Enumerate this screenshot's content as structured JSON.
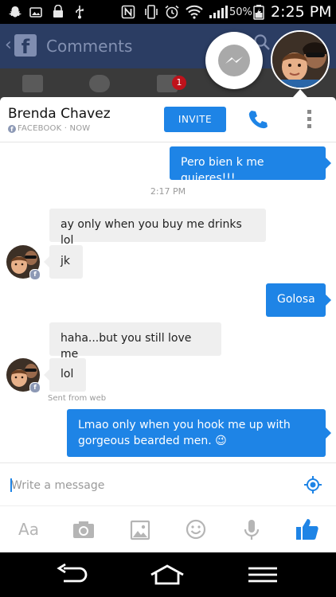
{
  "status_bar": {
    "battery": "50%",
    "time": "2:25 PM"
  },
  "background_app": {
    "title": "Comments",
    "notification_count": "1"
  },
  "chat": {
    "contact_name": "Brenda Chavez",
    "source": "FACEBOOK",
    "presence": "NOW",
    "invite_label": "INVITE"
  },
  "messages": [
    {
      "dir": "out",
      "text": "Pero bien k me quieres!!!"
    },
    {
      "type": "timestamp",
      "text": "2:17 PM"
    },
    {
      "dir": "in",
      "text": "ay only when you buy me drinks lol"
    },
    {
      "dir": "in",
      "text": "jk"
    },
    {
      "dir": "out",
      "text": "Golosa"
    },
    {
      "dir": "in",
      "text": "haha...but you still love me"
    },
    {
      "dir": "in",
      "text": "lol"
    },
    {
      "type": "meta",
      "text": "Sent from web"
    },
    {
      "dir": "out",
      "text": "Lmao only when you hook me up with gorgeous bearded men. 😉"
    }
  ],
  "composer": {
    "placeholder": "Write a message"
  },
  "toolbar": {
    "text_label": "Aa"
  },
  "colors": {
    "accent": "#1e84e6",
    "incoming_bubble": "#efefef",
    "facebook_bar": "#2b3d63"
  }
}
